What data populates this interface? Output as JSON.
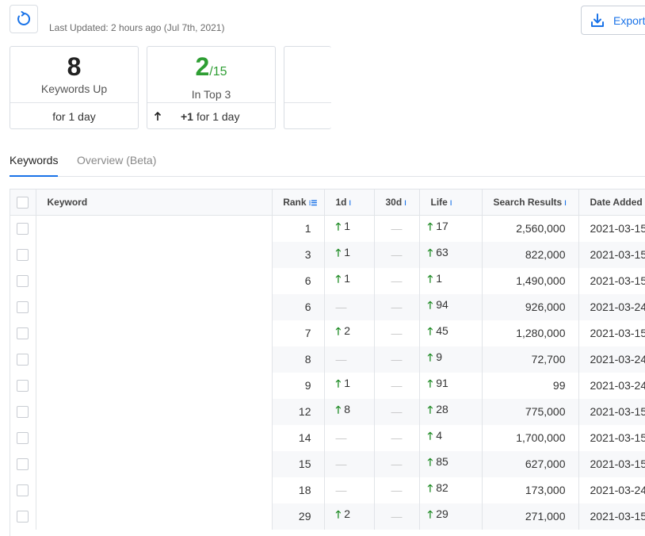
{
  "header": {
    "last_updated": "Last Updated: 2 hours ago (Jul 7th, 2021)",
    "export_label": "Export"
  },
  "cards": {
    "keywords_up": {
      "value": "8",
      "label": "Keywords Up",
      "footer": "for 1 day"
    },
    "in_top3": {
      "value": "2",
      "denominator": "/15",
      "label": "In Top 3",
      "footer_change": "+1",
      "footer_text": "for 1 day"
    }
  },
  "tabs": {
    "keywords": "Keywords",
    "overview": "Overview (Beta)"
  },
  "columns": {
    "keyword": "Keyword",
    "rank": "Rank",
    "d1": "1d",
    "d30": "30d",
    "life": "Life",
    "search_results": "Search Results",
    "date_added": "Date Added"
  },
  "rows": [
    {
      "rank": "1",
      "d1": "1",
      "d30": "—",
      "life": "17",
      "results": "2,560,000",
      "date": "2021-03-15"
    },
    {
      "rank": "3",
      "d1": "1",
      "d30": "—",
      "life": "63",
      "results": "822,000",
      "date": "2021-03-15"
    },
    {
      "rank": "6",
      "d1": "1",
      "d30": "—",
      "life": "1",
      "results": "1,490,000",
      "date": "2021-03-15"
    },
    {
      "rank": "6",
      "d1": "—",
      "d30": "—",
      "life": "94",
      "results": "926,000",
      "date": "2021-03-24"
    },
    {
      "rank": "7",
      "d1": "2",
      "d30": "—",
      "life": "45",
      "results": "1,280,000",
      "date": "2021-03-15"
    },
    {
      "rank": "8",
      "d1": "—",
      "d30": "—",
      "life": "9",
      "results": "72,700",
      "date": "2021-03-24"
    },
    {
      "rank": "9",
      "d1": "1",
      "d30": "—",
      "life": "91",
      "results": "99",
      "date": "2021-03-24"
    },
    {
      "rank": "12",
      "d1": "8",
      "d30": "—",
      "life": "28",
      "results": "775,000",
      "date": "2021-03-15"
    },
    {
      "rank": "14",
      "d1": "—",
      "d30": "—",
      "life": "4",
      "results": "1,700,000",
      "date": "2021-03-15"
    },
    {
      "rank": "15",
      "d1": "—",
      "d30": "—",
      "life": "85",
      "results": "627,000",
      "date": "2021-03-15"
    },
    {
      "rank": "18",
      "d1": "—",
      "d30": "—",
      "life": "82",
      "results": "173,000",
      "date": "2021-03-24"
    },
    {
      "rank": "29",
      "d1": "2",
      "d30": "—",
      "life": "29",
      "results": "271,000",
      "date": "2021-03-15"
    }
  ],
  "colors": {
    "accent": "#1a73e8",
    "positive": "#2e9e33"
  }
}
